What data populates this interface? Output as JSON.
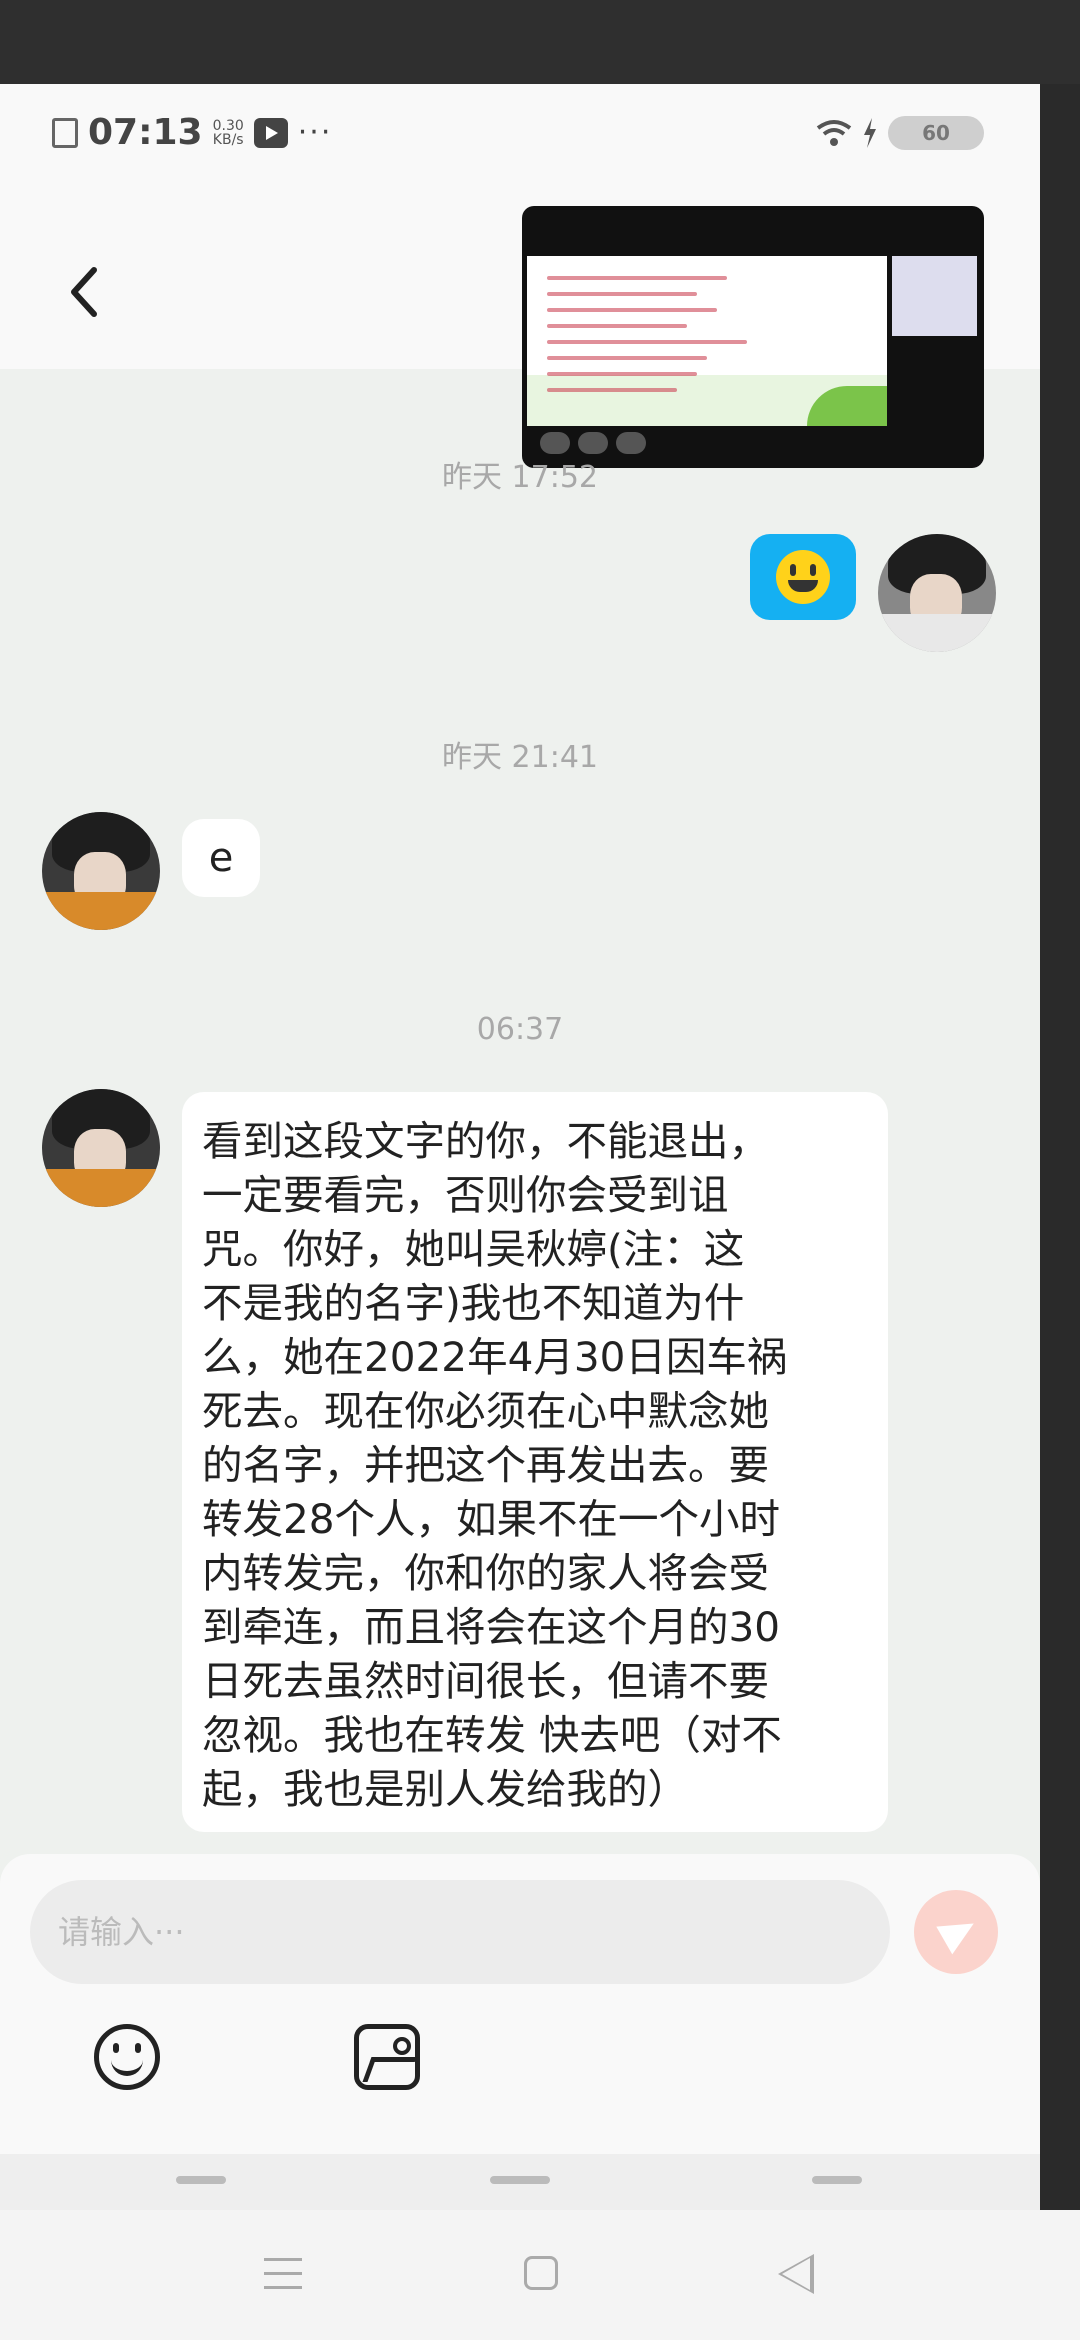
{
  "status_bar": {
    "time": "07:13",
    "net_speed_value": "0.30",
    "net_speed_unit": "KB/s",
    "more": "···",
    "battery": "60"
  },
  "header": {
    "back_icon": "chevron-left-icon"
  },
  "messages": [
    {
      "type": "image",
      "sender": "me",
      "icon": "screenshot-thumbnail"
    },
    {
      "type": "timestamp",
      "text": "昨天 17:52"
    },
    {
      "type": "emoji",
      "sender": "me",
      "icon": "smiley-face"
    },
    {
      "type": "timestamp",
      "text": "昨天 21:41"
    },
    {
      "type": "text",
      "sender": "other",
      "text": "e"
    },
    {
      "type": "timestamp",
      "text": "06:37"
    },
    {
      "type": "text",
      "sender": "other",
      "text": "看到这段文字的你，不能退出，\n一定要看完，否则你会受到诅\n咒。你好，她叫吴秋婷(注：这\n不是我的名字)我也不知道为什\n么，她在2022年4月30日因车祸\n死去。现在你必须在心中默念她\n的名字，并把这个再发出去。要\n转发28个人，如果不在一个小时\n内转发完，你和你的家人将会受\n到牵连，而且将会在这个月的30\n日死去虽然时间很长，但请不要\n忽视。我也在转发 快去吧（对不\n起，我也是别人发给我的）"
    }
  ],
  "composer": {
    "placeholder": "请输入···",
    "send_color": "#fbd3cc"
  },
  "accent": {
    "emoji_bubble": "#15b0f2",
    "chat_bg": "#eef1ee"
  }
}
